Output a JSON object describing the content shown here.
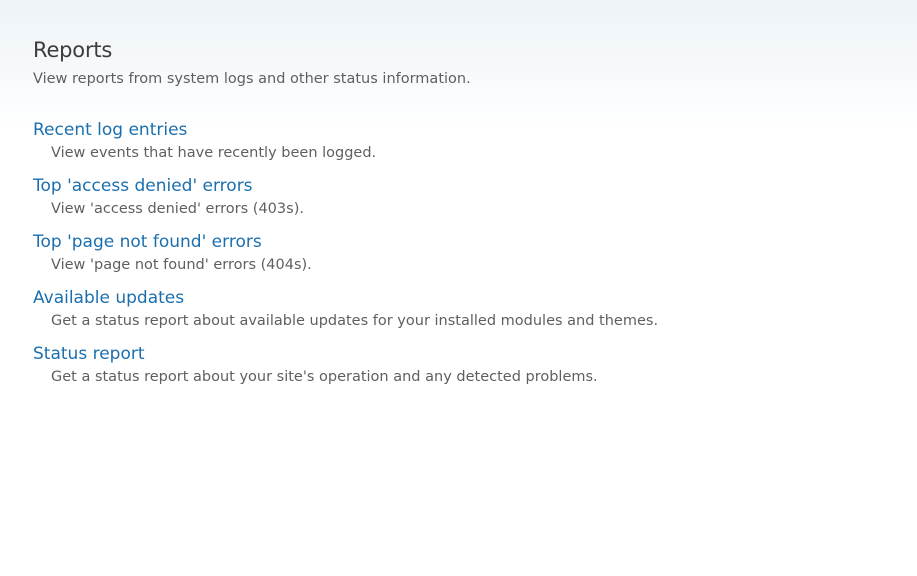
{
  "page": {
    "title": "Reports",
    "description": "View reports from system logs and other status information."
  },
  "items": [
    {
      "label": "Recent log entries",
      "description": "View events that have recently been logged."
    },
    {
      "label": "Top 'access denied' errors",
      "description": "View 'access denied' errors (403s)."
    },
    {
      "label": "Top 'page not found' errors",
      "description": "View 'page not found' errors (404s)."
    },
    {
      "label": "Available updates",
      "description": "Get a status report about available updates for your installed modules and themes."
    },
    {
      "label": "Status report",
      "description": "Get a status report about your site's operation and any detected problems."
    }
  ],
  "colors": {
    "link": "#1b6fae",
    "title": "#3c3c3c",
    "text": "#5f5f5f",
    "header_gradient_top": "#edf3f8"
  }
}
